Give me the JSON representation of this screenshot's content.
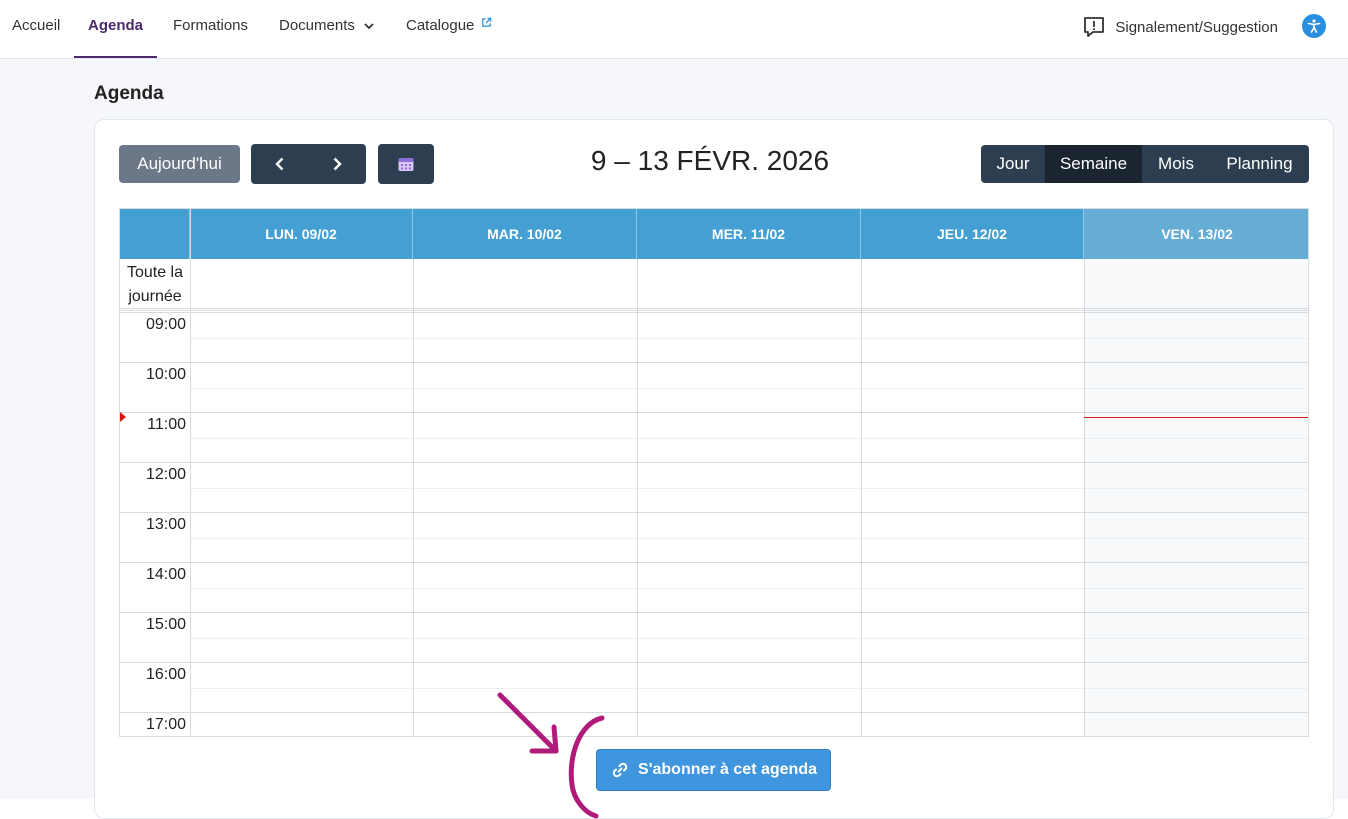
{
  "nav": {
    "items": [
      {
        "label": "Accueil",
        "active": false
      },
      {
        "label": "Agenda",
        "active": true
      },
      {
        "label": "Formations",
        "active": false
      },
      {
        "label": "Documents",
        "active": false
      },
      {
        "label": "Catalogue",
        "active": false
      }
    ],
    "signal_label": "Signalement/Suggestion"
  },
  "page": {
    "title": "Agenda"
  },
  "toolbar": {
    "today_label": "Aujourd'hui",
    "range_title": "9 – 13 FÉVR. 2026",
    "views": [
      {
        "label": "Jour",
        "active": false
      },
      {
        "label": "Semaine",
        "active": true
      },
      {
        "label": "Mois",
        "active": false
      },
      {
        "label": "Planning",
        "active": false
      }
    ]
  },
  "calendar": {
    "days": [
      "LUN. 09/02",
      "MAR. 10/02",
      "MER. 11/02",
      "JEU. 12/02",
      "VEN. 13/02"
    ],
    "today_index": 4,
    "allday_label": "Toute la journée",
    "hours": [
      "09:00",
      "10:00",
      "11:00",
      "12:00",
      "13:00",
      "14:00",
      "15:00",
      "16:00",
      "17:00"
    ]
  },
  "subscribe": {
    "label": "S'abonner à cet agenda"
  },
  "colors": {
    "accent": "#4a2a6b",
    "header_blue": "#44a0d3",
    "dark_button": "#2c3e50",
    "now_indicator": "#d9150f",
    "annotation": "#b01a7a"
  }
}
